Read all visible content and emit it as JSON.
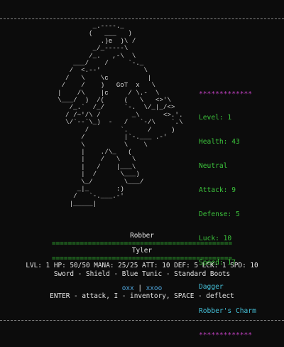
{
  "ascii_art": "           _.----._\n          (   ___   )\n             .)e  )\\ /\n           _/_-----\\ \n          /_.   ,-\\  \\\n      ___/    /     `-._\n     /  <.--'           \\\n    /   \\    \\c          |\n   /    /    )   GoT  x   \\\n  |    /\\    |c     / \\.-  \\\n  \\___/  )  /(     (   \\   <>'\\\n     /_.`  /_/     `-.  \\/_|_/<>\n    / /~'/\\ /        _\\      <>.'.\n    \\/`--`\\_)  -   /   `-/\\    `.\\\n         /        `.     /     )\n        /          |`-.___ .-'\n        \\          \\    \\\n        |    ./\\_   (\n        |    /   \\   \\\n        |   /    |___\\\n        |  /      \\___)\n        \\_/        \\___/\n       _|_       :)\n      /   `-.___.-'\n     |_____|",
  "panel": {
    "stars_top": "*************",
    "level": "Level: 1",
    "health": "Health: 43",
    "alignment": "Neutral",
    "attack": "Attack: 9",
    "defense": "Defense: 5",
    "luck": "Luck: 10",
    "speed": "Speed: 17",
    "weapon": "Dagger",
    "charm": "Robber's Charm",
    "stars_bottom": "*************"
  },
  "enemy_name": "Robber",
  "separator": "=============================================",
  "player": {
    "name": "Tyler",
    "stats": "LVL: 1 HP: 50/50 MANA: 25/25 ATT: 10 DEF: 5 LCK: 1 SPD: 10",
    "gear": "Sword - Shield - Blue Tunic - Standard Boots"
  },
  "combo": {
    "left": "oxx",
    "divider": " | ",
    "right": "xxoo"
  },
  "controls": "ENTER - attack, I - inventory, SPACE - deflect",
  "colors": {
    "background": "#0c0c0c",
    "text": "#e6e6e6",
    "green": "#3cc43c",
    "magenta": "#c040c0",
    "cyan": "#45c0d8",
    "blue": "#4fa8e0"
  }
}
